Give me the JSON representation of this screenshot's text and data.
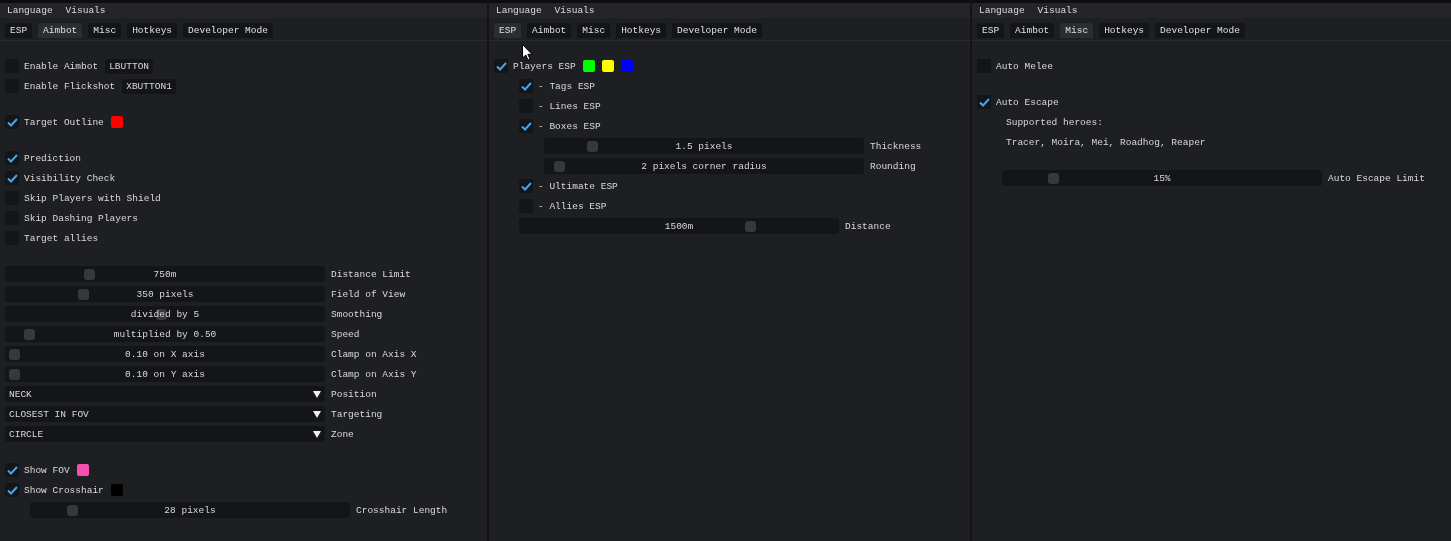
{
  "panels": [
    {
      "menu": [
        "Language",
        "Visuals"
      ],
      "tabs": [
        {
          "label": "ESP",
          "selected": false
        },
        {
          "label": "Aimbot",
          "selected": true
        },
        {
          "label": "Misc",
          "selected": false
        },
        {
          "label": "Hotkeys",
          "selected": false
        },
        {
          "label": "Developer Mode",
          "selected": false
        }
      ],
      "groups": [
        [
          {
            "kind": "checkbox",
            "label": "Enable Aimbot",
            "checked": false,
            "hotkey": "LBUTTON"
          },
          {
            "kind": "checkbox",
            "label": "Enable Flickshot",
            "checked": false,
            "hotkey": "XBUTTON1"
          }
        ],
        [
          {
            "kind": "checkbox",
            "label": "Target Outline",
            "checked": true,
            "swatches": [
              {
                "color": "#ff0000"
              }
            ]
          }
        ],
        [
          {
            "kind": "checkbox",
            "label": "Prediction",
            "checked": true
          },
          {
            "kind": "checkbox",
            "label": "Visibility Check",
            "checked": true
          },
          {
            "kind": "checkbox",
            "label": "Skip Players with Shield",
            "checked": false
          },
          {
            "kind": "checkbox",
            "label": "Skip Dashing Players",
            "checked": false
          },
          {
            "kind": "checkbox",
            "label": "Target allies",
            "checked": false
          }
        ],
        [
          {
            "kind": "slider",
            "value": "750m",
            "label": "Distance Limit",
            "level": 0.25
          },
          {
            "kind": "slider",
            "value": "350 pixels",
            "label": "Field of View",
            "level": 0.23
          },
          {
            "kind": "slider",
            "value": "divided by 5",
            "label": "Smoothing",
            "level": 0.49
          },
          {
            "kind": "slider",
            "value": "multiplied by 0.50",
            "label": "Speed",
            "level": 0.05
          },
          {
            "kind": "slider",
            "value": "0.10 on X axis",
            "label": "Clamp on Axis X",
            "level": 0
          },
          {
            "kind": "slider",
            "value": "0.10 on Y axis",
            "label": "Clamp on Axis Y",
            "level": 0
          },
          {
            "kind": "combo",
            "value": "NECK",
            "label": "Position"
          },
          {
            "kind": "combo",
            "value": "CLOSEST IN FOV",
            "label": "Targeting"
          },
          {
            "kind": "combo",
            "value": "CIRCLE",
            "label": "Zone"
          }
        ],
        [
          {
            "kind": "checkbox",
            "label": "Show FOV",
            "checked": true,
            "swatches": [
              {
                "color": "#f54fb0"
              }
            ]
          },
          {
            "kind": "checkbox",
            "label": "Show Crosshair",
            "checked": true,
            "swatches": [
              {
                "color": "#000000"
              }
            ],
            "children": [
              {
                "kind": "slider",
                "value": "28 pixels",
                "label": "Crosshair Length",
                "level": 0.11
              }
            ]
          }
        ]
      ]
    },
    {
      "menu": [
        "Language",
        "Visuals"
      ],
      "tabs": [
        {
          "label": "ESP",
          "selected": true
        },
        {
          "label": "Aimbot",
          "selected": false
        },
        {
          "label": "Misc",
          "selected": false
        },
        {
          "label": "Hotkeys",
          "selected": false
        },
        {
          "label": "Developer Mode",
          "selected": false
        }
      ],
      "groups": [
        [
          {
            "kind": "checkbox",
            "label": "Players ESP",
            "checked": true,
            "swatches": [
              {
                "color": "#00ff00"
              },
              {
                "color": "#ffff00"
              },
              {
                "color": "#0000ff"
              }
            ],
            "children": [
              {
                "kind": "checkbox",
                "label": "- Tags ESP",
                "checked": true
              },
              {
                "kind": "checkbox",
                "label": "- Lines ESP",
                "checked": false
              },
              {
                "kind": "checkbox",
                "label": "- Boxes ESP",
                "checked": true,
                "children": [
                  {
                    "kind": "slider",
                    "value": "1.5 pixels",
                    "label": "Thickness",
                    "level": 0.13
                  },
                  {
                    "kind": "slider",
                    "value": "2 pixels corner radius",
                    "label": "Rounding",
                    "level": 0.02
                  }
                ]
              },
              {
                "kind": "checkbox",
                "label": "- Ultimate ESP",
                "checked": true
              },
              {
                "kind": "checkbox",
                "label": "- Allies ESP",
                "checked": false
              },
              {
                "kind": "slider",
                "value": "1500m",
                "label": "Distance",
                "level": 0.74
              }
            ]
          }
        ]
      ]
    },
    {
      "menu": [
        "Language",
        "Visuals"
      ],
      "tabs": [
        {
          "label": "ESP",
          "selected": false
        },
        {
          "label": "Aimbot",
          "selected": false
        },
        {
          "label": "Misc",
          "selected": true
        },
        {
          "label": "Hotkeys",
          "selected": false
        },
        {
          "label": "Developer Mode",
          "selected": false
        }
      ],
      "groups": [
        [
          {
            "kind": "checkbox",
            "label": "Auto Melee",
            "checked": false
          }
        ],
        [
          {
            "kind": "checkbox",
            "label": "Auto Escape",
            "checked": true,
            "children": [
              {
                "kind": "text",
                "text": "Supported heroes:"
              },
              {
                "kind": "text",
                "text": "Tracer, Moira, Mei, Roadhog, Reaper"
              },
              {
                "kind": "slider",
                "value": "15%",
                "label": "Auto Escape Limit",
                "level": 0.14,
                "gap_before": true
              }
            ]
          }
        ]
      ]
    }
  ]
}
